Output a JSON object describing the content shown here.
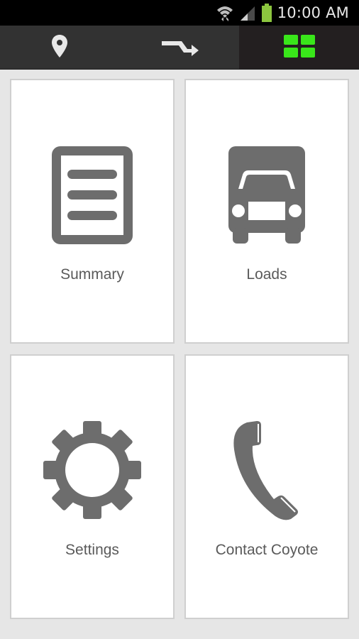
{
  "status_bar": {
    "time": "10:00 AM",
    "icons": [
      "wifi-icon",
      "signal-icon",
      "battery-icon"
    ],
    "battery_color": "#8cc63f"
  },
  "tabs": [
    {
      "name": "location",
      "icon": "location-pin-icon",
      "active": false
    },
    {
      "name": "route",
      "icon": "route-arrow-icon",
      "active": false
    },
    {
      "name": "dashboard",
      "icon": "grid-icon",
      "active": true
    }
  ],
  "tiles": [
    {
      "label": "Summary",
      "icon": "document-icon"
    },
    {
      "label": "Loads",
      "icon": "truck-icon"
    },
    {
      "label": "Settings",
      "icon": "gear-icon"
    },
    {
      "label": "Contact Coyote",
      "icon": "phone-icon"
    }
  ],
  "colors": {
    "accent": "#39e61a",
    "icon_gray": "#6d6d6d",
    "tab_bar": "#323232",
    "tab_active": "#231f20",
    "background": "#e6e6e6"
  }
}
